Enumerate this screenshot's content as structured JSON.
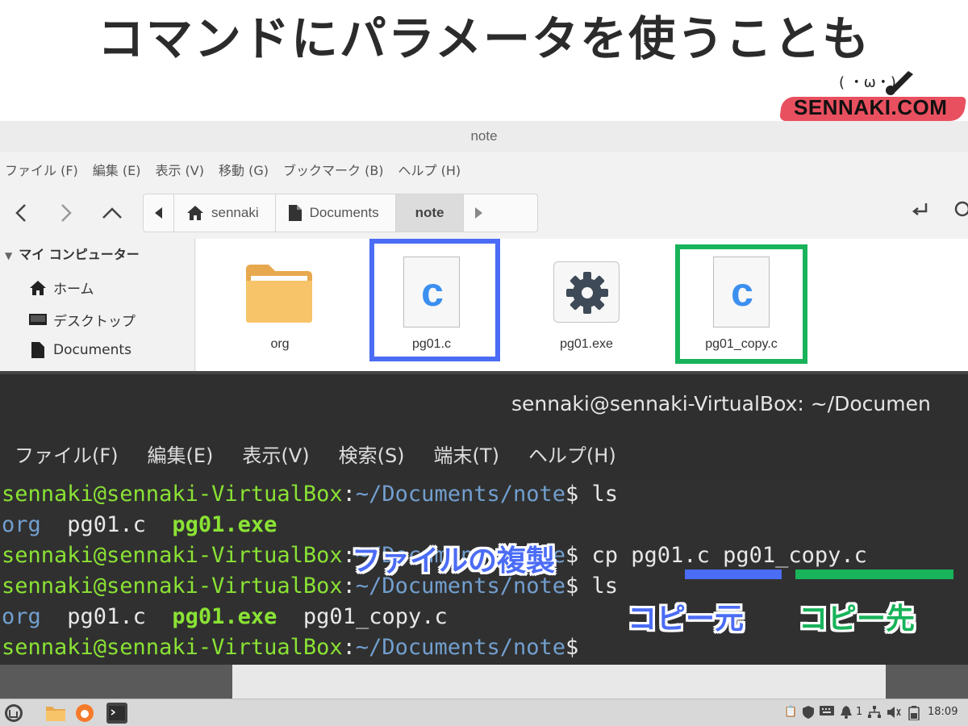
{
  "headline": "コマンドにパラメータを使うことも",
  "logo": {
    "face": "( ・ω・)",
    "text": "SENNAKI.COM",
    "color": "#e9505f"
  },
  "file_manager": {
    "title": "note",
    "menu": [
      "ファイル (F)",
      "編集 (E)",
      "表示 (V)",
      "移動 (G)",
      "ブックマーク (B)",
      "ヘルプ (H)"
    ],
    "nav": {
      "back": "chevron-left-icon",
      "forward": "chevron-right-icon",
      "up": "chevron-up-icon"
    },
    "breadcrumbs": [
      "sennaki",
      "Documents",
      "note"
    ],
    "sidebar": {
      "header": "マイ コンピューター",
      "items": [
        "ホーム",
        "デスクトップ",
        "Documents"
      ]
    },
    "files": [
      "org",
      "pg01.c",
      "pg01.exe",
      "pg01_copy.c"
    ],
    "file_icon_letter": "c"
  },
  "terminal": {
    "title": "sennaki@sennaki-VirtualBox: ~/Documen",
    "menu": [
      "ファイル(F)",
      "編集(E)",
      "表示(V)",
      "検索(S)",
      "端末(T)",
      "ヘルプ(H)"
    ],
    "prompt_user": "sennaki@sennaki-VirtualBox",
    "prompt_path": "~/Documents/note",
    "colon": ":",
    "dollar": "$",
    "lines": {
      "cmd1": " ls",
      "ls1": {
        "a": "org",
        "b": "pg01.c",
        "c": "pg01.exe"
      },
      "cmd2": " cp pg01.c pg01_copy.c",
      "cmd3": " ls",
      "ls2": {
        "a": "org",
        "b": "pg01.c",
        "c": "pg01.exe",
        "d": "pg01_copy.c"
      }
    }
  },
  "annotations": {
    "copy_title": "ファイルの複製",
    "source": "コピー元",
    "destination": "コピー先",
    "source_color": "#4b6cf5",
    "destination_color": "#18b35a"
  },
  "taskbar": {
    "clock": "18:09",
    "battery_count": "1"
  }
}
